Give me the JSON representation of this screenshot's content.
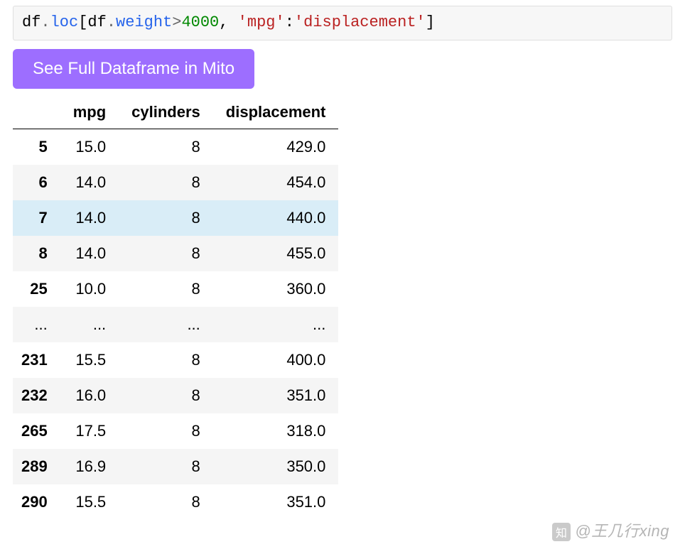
{
  "code": {
    "tokens": [
      {
        "text": "df",
        "class": "tok-var"
      },
      {
        "text": ".",
        "class": "tok-op"
      },
      {
        "text": "loc",
        "class": "tok-attr"
      },
      {
        "text": "[",
        "class": "tok-punct"
      },
      {
        "text": "df",
        "class": "tok-var"
      },
      {
        "text": ".",
        "class": "tok-op"
      },
      {
        "text": "weight",
        "class": "tok-attr"
      },
      {
        "text": ">",
        "class": "tok-op"
      },
      {
        "text": "4000",
        "class": "tok-num"
      },
      {
        "text": ", ",
        "class": "tok-punct"
      },
      {
        "text": "'mpg'",
        "class": "tok-str"
      },
      {
        "text": ":",
        "class": "tok-punct"
      },
      {
        "text": "'displacement'",
        "class": "tok-str"
      },
      {
        "text": "]",
        "class": "tok-punct"
      }
    ]
  },
  "button": {
    "label": "See Full Dataframe in Mito"
  },
  "table": {
    "columns": [
      "mpg",
      "cylinders",
      "displacement"
    ],
    "rows": [
      {
        "index": "5",
        "cells": [
          "15.0",
          "8",
          "429.0"
        ],
        "highlighted": false
      },
      {
        "index": "6",
        "cells": [
          "14.0",
          "8",
          "454.0"
        ],
        "highlighted": false
      },
      {
        "index": "7",
        "cells": [
          "14.0",
          "8",
          "440.0"
        ],
        "highlighted": true
      },
      {
        "index": "8",
        "cells": [
          "14.0",
          "8",
          "455.0"
        ],
        "highlighted": false
      },
      {
        "index": "25",
        "cells": [
          "10.0",
          "8",
          "360.0"
        ],
        "highlighted": false
      },
      {
        "index": "...",
        "cells": [
          "...",
          "...",
          "..."
        ],
        "ellipsis": true
      },
      {
        "index": "231",
        "cells": [
          "15.5",
          "8",
          "400.0"
        ],
        "highlighted": false
      },
      {
        "index": "232",
        "cells": [
          "16.0",
          "8",
          "351.0"
        ],
        "highlighted": false
      },
      {
        "index": "265",
        "cells": [
          "17.5",
          "8",
          "318.0"
        ],
        "highlighted": false
      },
      {
        "index": "289",
        "cells": [
          "16.9",
          "8",
          "350.0"
        ],
        "highlighted": false
      },
      {
        "index": "290",
        "cells": [
          "15.5",
          "8",
          "351.0"
        ],
        "highlighted": false
      }
    ]
  },
  "watermark": {
    "text": "@王几行xing"
  }
}
